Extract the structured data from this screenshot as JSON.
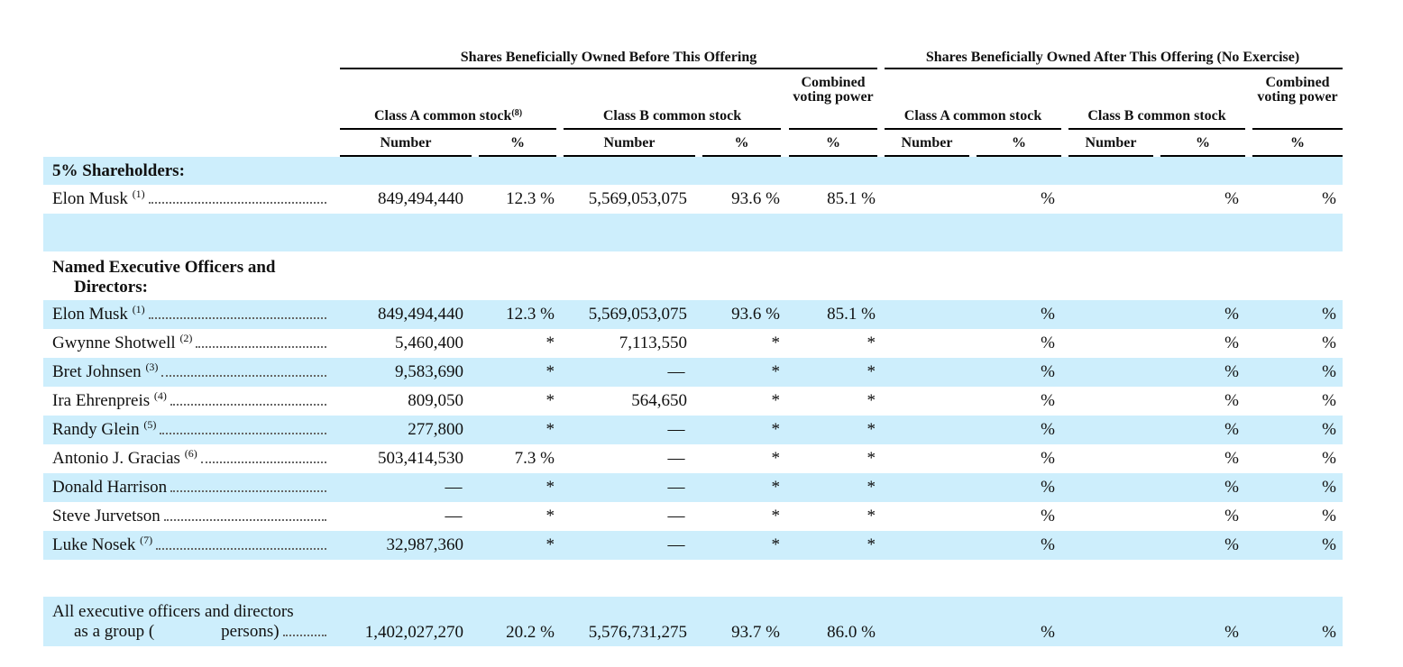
{
  "headers": {
    "before_offering": "Shares Beneficially Owned Before This Offering",
    "after_offering": "Shares Beneficially Owned After This Offering (No Exercise)",
    "class_a_before": "Class A common stock",
    "class_a_before_note": "(8)",
    "class_b_before": "Class B common stock",
    "combined_before": "Combined voting power",
    "class_a_after": "Class A common stock",
    "class_b_after": "Class B common stock",
    "combined_after": "Combined voting power",
    "number": "Number",
    "percent": "%"
  },
  "sections": {
    "five_percent": "5% Shareholders:",
    "officers_line1": "Named Executive Officers and",
    "officers_line2": "Directors:"
  },
  "rows": {
    "musk_5pct": {
      "name": "Elon Musk",
      "note": "(1)",
      "a_num": "849,494,440",
      "a_pct": "12.3 %",
      "b_num": "5,569,053,075",
      "b_pct": "93.6 %",
      "comb": "85.1 %",
      "after_a_pct": "%",
      "after_b_pct": "%",
      "after_comb": "%"
    },
    "officers": [
      {
        "name": "Elon Musk",
        "note": "(1)",
        "a_num": "849,494,440",
        "a_pct": "12.3 %",
        "b_num": "5,569,053,075",
        "b_pct": "93.6 %",
        "comb": "85.1 %",
        "after_a_pct": "%",
        "after_b_pct": "%",
        "after_comb": "%"
      },
      {
        "name": "Gwynne Shotwell",
        "note": "(2)",
        "a_num": "5,460,400",
        "a_pct": "*",
        "b_num": "7,113,550",
        "b_pct": "*",
        "comb": "*",
        "after_a_pct": "%",
        "after_b_pct": "%",
        "after_comb": "%"
      },
      {
        "name": "Bret Johnsen",
        "note": "(3)",
        "a_num": "9,583,690",
        "a_pct": "*",
        "b_num": "—",
        "b_pct": "*",
        "comb": "*",
        "after_a_pct": "%",
        "after_b_pct": "%",
        "after_comb": "%"
      },
      {
        "name": "Ira Ehrenpreis",
        "note": "(4)",
        "a_num": "809,050",
        "a_pct": "*",
        "b_num": "564,650",
        "b_pct": "*",
        "comb": "*",
        "after_a_pct": "%",
        "after_b_pct": "%",
        "after_comb": "%"
      },
      {
        "name": "Randy Glein",
        "note": "(5)",
        "a_num": "277,800",
        "a_pct": "*",
        "b_num": "—",
        "b_pct": "*",
        "comb": "*",
        "after_a_pct": "%",
        "after_b_pct": "%",
        "after_comb": "%"
      },
      {
        "name": "Antonio J. Gracias",
        "note": "(6)",
        "a_num": "503,414,530",
        "a_pct": "7.3 %",
        "b_num": "—",
        "b_pct": "*",
        "comb": "*",
        "after_a_pct": "%",
        "after_b_pct": "%",
        "after_comb": "%"
      },
      {
        "name": "Donald Harrison",
        "note": "",
        "a_num": "—",
        "a_pct": "*",
        "b_num": "—",
        "b_pct": "*",
        "comb": "*",
        "after_a_pct": "%",
        "after_b_pct": "%",
        "after_comb": "%"
      },
      {
        "name": "Steve Jurvetson",
        "note": "",
        "a_num": "—",
        "a_pct": "*",
        "b_num": "—",
        "b_pct": "*",
        "comb": "*",
        "after_a_pct": "%",
        "after_b_pct": "%",
        "after_comb": "%"
      },
      {
        "name": "Luke Nosek",
        "note": "(7)",
        "a_num": "32,987,360",
        "a_pct": "*",
        "b_num": "—",
        "b_pct": "*",
        "comb": "*",
        "after_a_pct": "%",
        "after_b_pct": "%",
        "after_comb": "%"
      }
    ],
    "group": {
      "line1": "All executive officers and directors",
      "line2_a": "as a group (",
      "line2_b": "persons)",
      "a_num": "1,402,027,270",
      "a_pct": "20.2 %",
      "b_num": "5,576,731,275",
      "b_pct": "93.7 %",
      "comb": "86.0 %",
      "after_a_pct": "%",
      "after_b_pct": "%",
      "after_comb": "%"
    }
  },
  "colors": {
    "band": "#cdeefc",
    "rule": "#000000"
  }
}
